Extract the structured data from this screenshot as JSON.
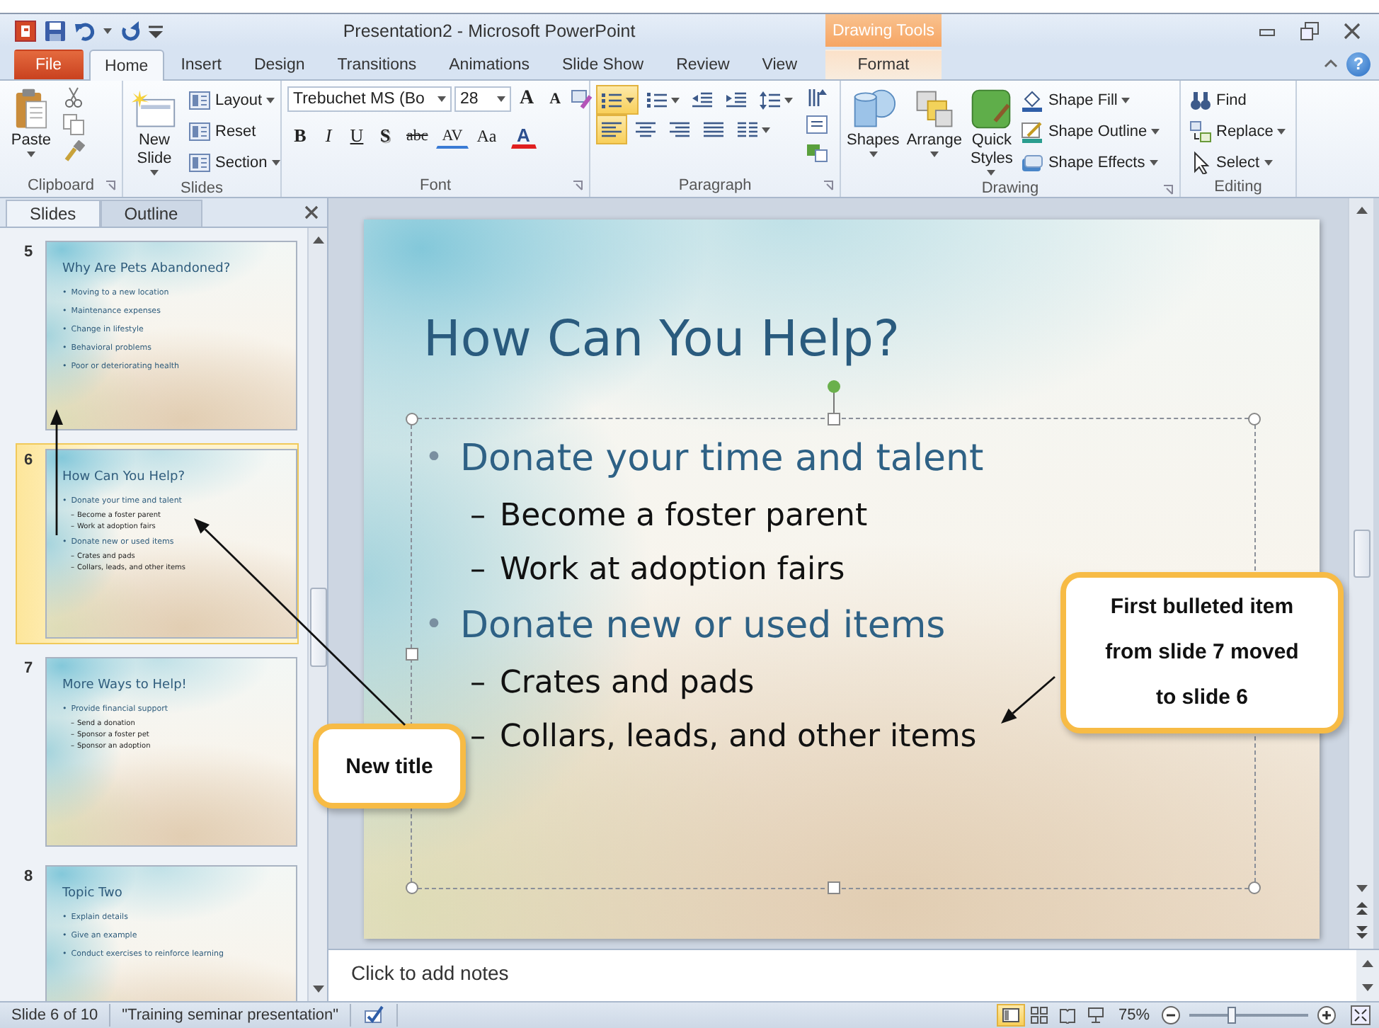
{
  "window": {
    "title": "Presentation2 - Microsoft PowerPoint",
    "context_label": "Drawing Tools",
    "help": "?"
  },
  "tabs": [
    {
      "label": "File",
      "kind": "file",
      "selected": false
    },
    {
      "label": "Home",
      "kind": "normal",
      "selected": true
    },
    {
      "label": "Insert",
      "kind": "normal",
      "selected": false
    },
    {
      "label": "Design",
      "kind": "normal",
      "selected": false
    },
    {
      "label": "Transitions",
      "kind": "normal",
      "selected": false
    },
    {
      "label": "Animations",
      "kind": "normal",
      "selected": false
    },
    {
      "label": "Slide Show",
      "kind": "normal",
      "selected": false
    },
    {
      "label": "Review",
      "kind": "normal",
      "selected": false
    },
    {
      "label": "View",
      "kind": "normal",
      "selected": false
    },
    {
      "label": "Format",
      "kind": "contextual",
      "selected": false
    }
  ],
  "ribbon": {
    "clipboard": {
      "label": "Clipboard",
      "paste": "Paste"
    },
    "slides": {
      "label": "Slides",
      "new_slide": [
        "New",
        "Slide"
      ],
      "items": [
        {
          "label": "Layout",
          "dropdown": true
        },
        {
          "label": "Reset",
          "dropdown": false
        },
        {
          "label": "Section",
          "dropdown": true
        }
      ]
    },
    "font": {
      "label": "Font",
      "font_name": "Trebuchet MS (Bo",
      "font_size": "28",
      "size_buttons": [
        {
          "label": "A",
          "kind": "grow"
        },
        {
          "label": "A",
          "kind": "shrink"
        }
      ],
      "format_buttons": [
        {
          "label": "B",
          "kind": "bold"
        },
        {
          "label": "I",
          "kind": "italic"
        },
        {
          "label": "U",
          "kind": "underline"
        },
        {
          "label": "S",
          "kind": "shadow"
        },
        {
          "label": "abc",
          "kind": "strike"
        },
        {
          "label": "AV",
          "kind": "spacing"
        },
        {
          "label": "Aa",
          "kind": "case"
        },
        {
          "label": "A",
          "kind": "color"
        }
      ]
    },
    "paragraph": {
      "label": "Paragraph",
      "buttons": [
        {
          "kind": "bullets",
          "selected": true,
          "dropdown": true
        },
        {
          "kind": "numbering",
          "selected": false,
          "dropdown": true
        },
        {
          "kind": "decrease-indent",
          "selected": false,
          "dropdown": false
        },
        {
          "kind": "increase-indent",
          "selected": false,
          "dropdown": false
        },
        {
          "kind": "line-spacing",
          "selected": false,
          "dropdown": true
        },
        {
          "kind": "align-left",
          "selected": true,
          "dropdown": false
        },
        {
          "kind": "align-center",
          "selected": false,
          "dropdown": false
        },
        {
          "kind": "align-right",
          "selected": false,
          "dropdown": false
        },
        {
          "kind": "justify",
          "selected": false,
          "dropdown": false
        },
        {
          "kind": "columns",
          "selected": false,
          "dropdown": true
        }
      ]
    },
    "drawing": {
      "label": "Drawing",
      "shapes": "Shapes",
      "arrange": "Arrange",
      "quick_styles": [
        "Quick",
        "Styles"
      ],
      "items": [
        {
          "label": "Shape Fill",
          "kind": "fill"
        },
        {
          "label": "Shape Outline",
          "kind": "outline"
        },
        {
          "label": "Shape Effects",
          "kind": "effects"
        }
      ]
    },
    "editing": {
      "label": "Editing",
      "items": [
        {
          "label": "Find",
          "kind": "find",
          "dropdown": false
        },
        {
          "label": "Replace",
          "kind": "replace",
          "dropdown": true
        },
        {
          "label": "Select",
          "kind": "select",
          "dropdown": true
        }
      ]
    }
  },
  "slides_panel": {
    "tabs": [
      {
        "label": "Slides",
        "selected": true
      },
      {
        "label": "Outline",
        "selected": false
      }
    ],
    "thumbnails": [
      {
        "number": "5",
        "title": "Why Are Pets Abandoned?",
        "selected": false,
        "bullets": [
          {
            "marker": "•",
            "text": "Moving to a new location"
          },
          {
            "marker": "•",
            "text": "Maintenance expenses"
          },
          {
            "marker": "•",
            "text": "Change in lifestyle"
          },
          {
            "marker": "•",
            "text": "Behavioral problems"
          },
          {
            "marker": "•",
            "text": "Poor or deteriorating health"
          }
        ]
      },
      {
        "number": "6",
        "title": "How Can You Help?",
        "selected": true,
        "bullets": [
          {
            "marker": "•",
            "text": "Donate your time and talent",
            "children": [
              {
                "marker": "–",
                "text": "Become a foster parent"
              },
              {
                "marker": "–",
                "text": "Work at adoption fairs"
              }
            ]
          },
          {
            "marker": "•",
            "text": "Donate new or used items",
            "children": [
              {
                "marker": "–",
                "text": "Crates and pads"
              },
              {
                "marker": "–",
                "text": "Collars, leads, and other items"
              }
            ]
          }
        ]
      },
      {
        "number": "7",
        "title": "More Ways to Help!",
        "selected": false,
        "bullets": [
          {
            "marker": "•",
            "text": "Provide financial support",
            "children": [
              {
                "marker": "–",
                "text": "Send a donation"
              },
              {
                "marker": "–",
                "text": "Sponsor a foster pet"
              },
              {
                "marker": "–",
                "text": "Sponsor an adoption"
              }
            ]
          }
        ]
      },
      {
        "number": "8",
        "title": "Topic Two",
        "selected": false,
        "bullets": [
          {
            "marker": "•",
            "text": "Explain details"
          },
          {
            "marker": "•",
            "text": "Give an example"
          },
          {
            "marker": "•",
            "text": "Conduct exercises to reinforce learning"
          }
        ]
      }
    ]
  },
  "slide": {
    "title": "How Can You Help?",
    "bullets": [
      {
        "marker": "•",
        "text": "Donate your time and talent",
        "children": [
          {
            "marker": "–",
            "text": "Become a foster parent"
          },
          {
            "marker": "–",
            "text": "Work at adoption fairs"
          }
        ]
      },
      {
        "marker": "•",
        "text": "Donate new or used items",
        "children": [
          {
            "marker": "–",
            "text": "Crates and pads"
          },
          {
            "marker": "–",
            "text": "Collars, leads, and other items"
          }
        ]
      }
    ]
  },
  "notes": {
    "placeholder": "Click to add notes"
  },
  "callouts": [
    {
      "text": "New title"
    },
    {
      "text": "First bulleted item from slide 7 moved to slide 6"
    }
  ],
  "status_bar": {
    "slide": "Slide 6 of 10",
    "theme": "\"Training seminar presentation\"",
    "zoom": "75%",
    "zoom_level": {
      "level": 0.36
    },
    "view_buttons": [
      {
        "kind": "normal",
        "selected": true
      },
      {
        "kind": "sorter",
        "selected": false
      },
      {
        "kind": "reading",
        "selected": false
      },
      {
        "kind": "slideshow",
        "selected": false
      }
    ]
  }
}
